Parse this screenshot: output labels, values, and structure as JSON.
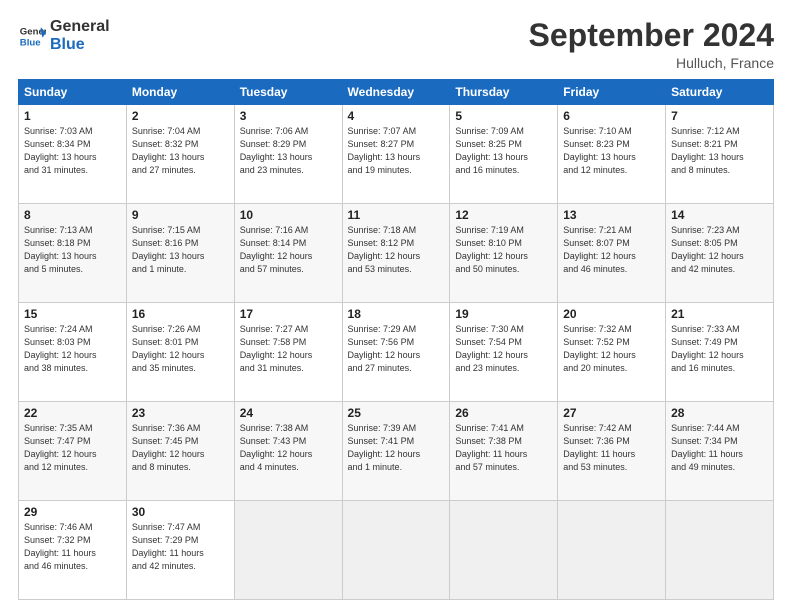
{
  "logo": {
    "line1": "General",
    "line2": "Blue"
  },
  "title": "September 2024",
  "location": "Hulluch, France",
  "headers": [
    "Sunday",
    "Monday",
    "Tuesday",
    "Wednesday",
    "Thursday",
    "Friday",
    "Saturday"
  ],
  "weeks": [
    [
      {
        "day": "1",
        "info": "Sunrise: 7:03 AM\nSunset: 8:34 PM\nDaylight: 13 hours\nand 31 minutes."
      },
      {
        "day": "2",
        "info": "Sunrise: 7:04 AM\nSunset: 8:32 PM\nDaylight: 13 hours\nand 27 minutes."
      },
      {
        "day": "3",
        "info": "Sunrise: 7:06 AM\nSunset: 8:29 PM\nDaylight: 13 hours\nand 23 minutes."
      },
      {
        "day": "4",
        "info": "Sunrise: 7:07 AM\nSunset: 8:27 PM\nDaylight: 13 hours\nand 19 minutes."
      },
      {
        "day": "5",
        "info": "Sunrise: 7:09 AM\nSunset: 8:25 PM\nDaylight: 13 hours\nand 16 minutes."
      },
      {
        "day": "6",
        "info": "Sunrise: 7:10 AM\nSunset: 8:23 PM\nDaylight: 13 hours\nand 12 minutes."
      },
      {
        "day": "7",
        "info": "Sunrise: 7:12 AM\nSunset: 8:21 PM\nDaylight: 13 hours\nand 8 minutes."
      }
    ],
    [
      {
        "day": "8",
        "info": "Sunrise: 7:13 AM\nSunset: 8:18 PM\nDaylight: 13 hours\nand 5 minutes."
      },
      {
        "day": "9",
        "info": "Sunrise: 7:15 AM\nSunset: 8:16 PM\nDaylight: 13 hours\nand 1 minute."
      },
      {
        "day": "10",
        "info": "Sunrise: 7:16 AM\nSunset: 8:14 PM\nDaylight: 12 hours\nand 57 minutes."
      },
      {
        "day": "11",
        "info": "Sunrise: 7:18 AM\nSunset: 8:12 PM\nDaylight: 12 hours\nand 53 minutes."
      },
      {
        "day": "12",
        "info": "Sunrise: 7:19 AM\nSunset: 8:10 PM\nDaylight: 12 hours\nand 50 minutes."
      },
      {
        "day": "13",
        "info": "Sunrise: 7:21 AM\nSunset: 8:07 PM\nDaylight: 12 hours\nand 46 minutes."
      },
      {
        "day": "14",
        "info": "Sunrise: 7:23 AM\nSunset: 8:05 PM\nDaylight: 12 hours\nand 42 minutes."
      }
    ],
    [
      {
        "day": "15",
        "info": "Sunrise: 7:24 AM\nSunset: 8:03 PM\nDaylight: 12 hours\nand 38 minutes."
      },
      {
        "day": "16",
        "info": "Sunrise: 7:26 AM\nSunset: 8:01 PM\nDaylight: 12 hours\nand 35 minutes."
      },
      {
        "day": "17",
        "info": "Sunrise: 7:27 AM\nSunset: 7:58 PM\nDaylight: 12 hours\nand 31 minutes."
      },
      {
        "day": "18",
        "info": "Sunrise: 7:29 AM\nSunset: 7:56 PM\nDaylight: 12 hours\nand 27 minutes."
      },
      {
        "day": "19",
        "info": "Sunrise: 7:30 AM\nSunset: 7:54 PM\nDaylight: 12 hours\nand 23 minutes."
      },
      {
        "day": "20",
        "info": "Sunrise: 7:32 AM\nSunset: 7:52 PM\nDaylight: 12 hours\nand 20 minutes."
      },
      {
        "day": "21",
        "info": "Sunrise: 7:33 AM\nSunset: 7:49 PM\nDaylight: 12 hours\nand 16 minutes."
      }
    ],
    [
      {
        "day": "22",
        "info": "Sunrise: 7:35 AM\nSunset: 7:47 PM\nDaylight: 12 hours\nand 12 minutes."
      },
      {
        "day": "23",
        "info": "Sunrise: 7:36 AM\nSunset: 7:45 PM\nDaylight: 12 hours\nand 8 minutes."
      },
      {
        "day": "24",
        "info": "Sunrise: 7:38 AM\nSunset: 7:43 PM\nDaylight: 12 hours\nand 4 minutes."
      },
      {
        "day": "25",
        "info": "Sunrise: 7:39 AM\nSunset: 7:41 PM\nDaylight: 12 hours\nand 1 minute."
      },
      {
        "day": "26",
        "info": "Sunrise: 7:41 AM\nSunset: 7:38 PM\nDaylight: 11 hours\nand 57 minutes."
      },
      {
        "day": "27",
        "info": "Sunrise: 7:42 AM\nSunset: 7:36 PM\nDaylight: 11 hours\nand 53 minutes."
      },
      {
        "day": "28",
        "info": "Sunrise: 7:44 AM\nSunset: 7:34 PM\nDaylight: 11 hours\nand 49 minutes."
      }
    ],
    [
      {
        "day": "29",
        "info": "Sunrise: 7:46 AM\nSunset: 7:32 PM\nDaylight: 11 hours\nand 46 minutes."
      },
      {
        "day": "30",
        "info": "Sunrise: 7:47 AM\nSunset: 7:29 PM\nDaylight: 11 hours\nand 42 minutes."
      },
      {
        "day": "",
        "info": ""
      },
      {
        "day": "",
        "info": ""
      },
      {
        "day": "",
        "info": ""
      },
      {
        "day": "",
        "info": ""
      },
      {
        "day": "",
        "info": ""
      }
    ]
  ]
}
